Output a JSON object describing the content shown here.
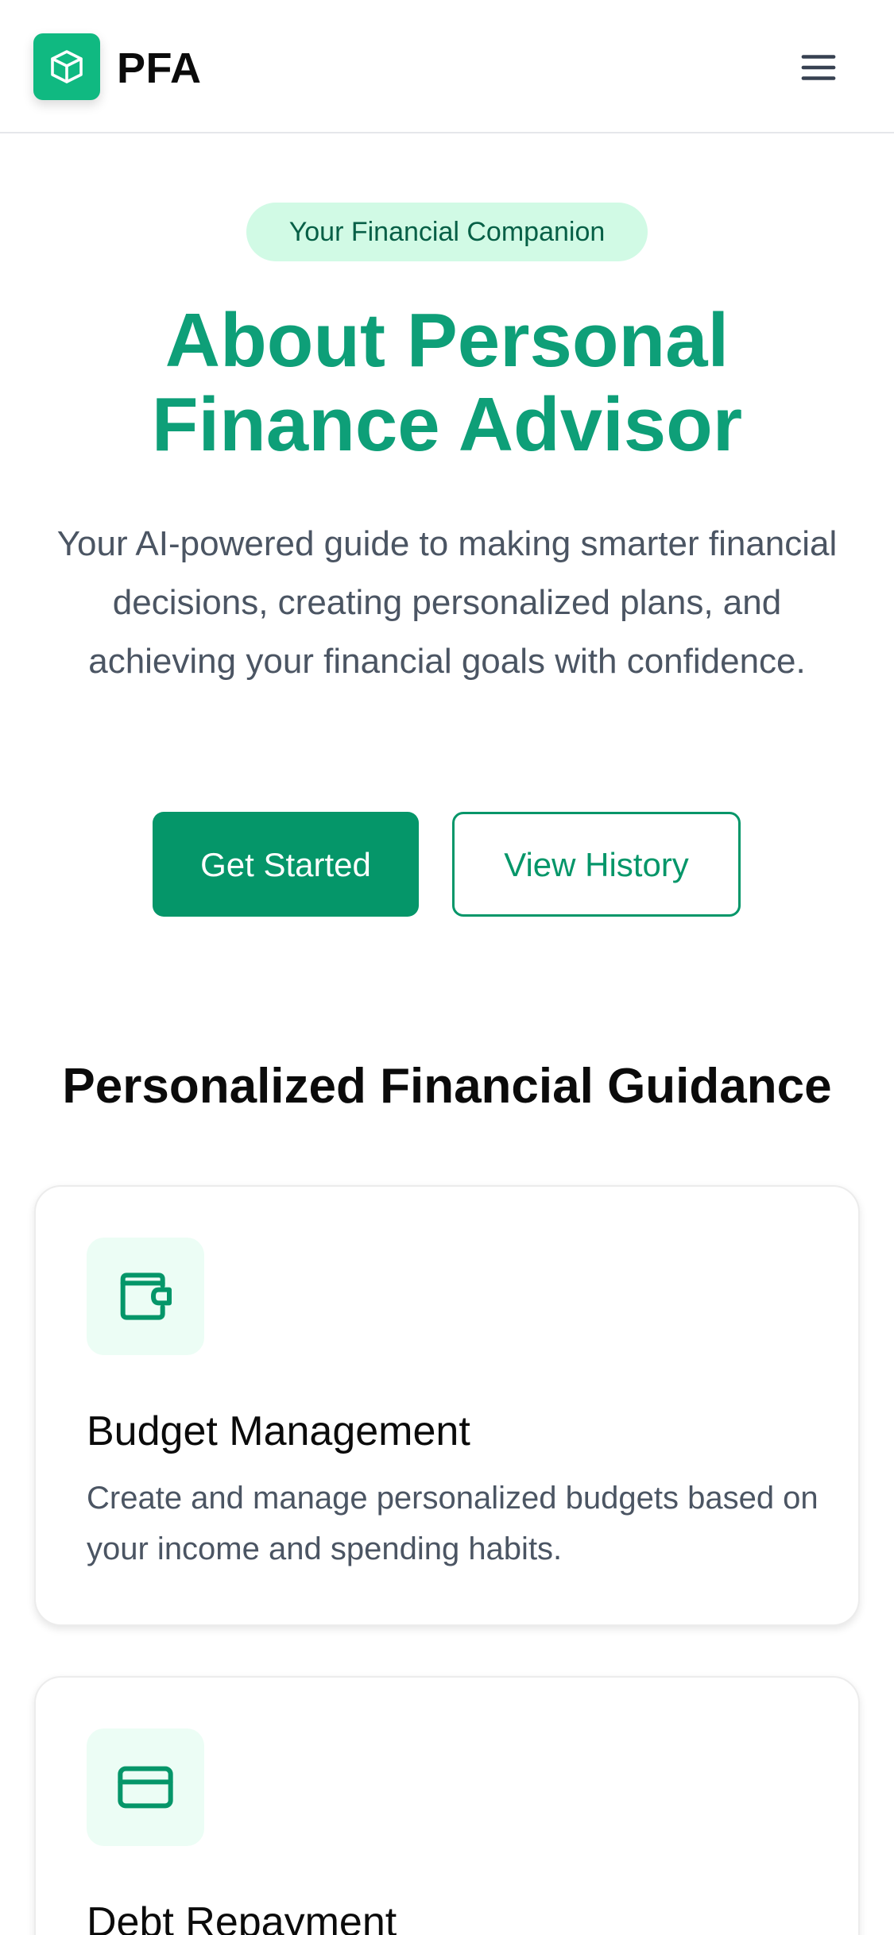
{
  "header": {
    "brand": "PFA",
    "logo_icon": "cube-icon",
    "menu_icon": "hamburger-menu-icon"
  },
  "hero": {
    "badge": "Your Financial Companion",
    "title_line1": "About Personal",
    "title_line2": "Finance Advisor",
    "subtitle": "Your AI-powered guide to making smarter financial decisions, creating personalized plans, and achieving your financial goals with confidence.",
    "primary_button": "Get Started",
    "secondary_button": "View History"
  },
  "features": {
    "heading": "Personalized Financial Guidance",
    "items": [
      {
        "icon": "wallet-icon",
        "title": "Budget Management",
        "description": "Create and manage personalized budgets based on your income and spending habits."
      },
      {
        "icon": "credit-card-icon",
        "title": "Debt Repayment"
      }
    ]
  },
  "colors": {
    "brand": "#10b981",
    "primary": "#059669",
    "title": "#0e9f78",
    "badge_bg": "#d1fae5",
    "badge_text": "#065f46",
    "icon_bg": "#ecfdf5"
  }
}
